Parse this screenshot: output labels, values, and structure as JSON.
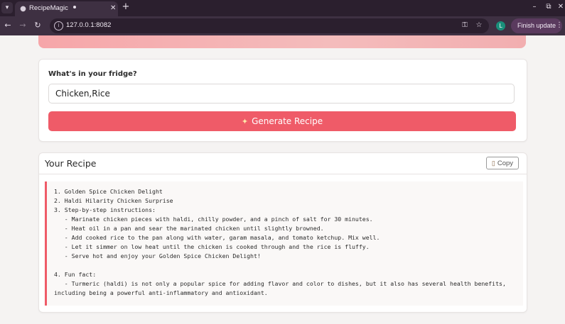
{
  "browser": {
    "tab_title": "RecipeMagic",
    "url": "127.0.0.1:8082",
    "profile_initial": "L",
    "finish_update_label": "Finish update"
  },
  "form": {
    "label": "What's in your fridge?",
    "ingredients_value": "Chicken,Rice",
    "generate_label": "Generate Recipe"
  },
  "recipe": {
    "heading": "Your Recipe",
    "copy_label": "Copy",
    "lines": [
      "1. Golden Spice Chicken Delight",
      "2. Haldi Hilarity Chicken Surprise",
      "3. Step-by-step instructions:",
      "   - Marinate chicken pieces with haldi, chilly powder, and a pinch of salt for 30 minutes.",
      "   - Heat oil in a pan and sear the marinated chicken until slightly browned.",
      "   - Add cooked rice to the pan along with water, garam masala, and tomato ketchup. Mix well.",
      "   - Let it simmer on low heat until the chicken is cooked through and the rice is fluffy.",
      "   - Serve hot and enjoy your Golden Spice Chicken Delight!",
      "",
      "4. Fun fact:",
      "   - Turmeric (haldi) is not only a popular spice for adding flavor and color to dishes, but it also has several health benefits, including being a powerful anti-inflammatory and antioxidant."
    ]
  },
  "icons": {
    "tab_list": "chevron-down-icon",
    "favicon": "globe-icon",
    "new_tab": "plus-icon",
    "back": "arrow-left-icon",
    "forward": "arrow-right-icon",
    "reload": "reload-icon",
    "site_info": "info-icon",
    "password": "key-icon",
    "bookmark": "star-icon",
    "generate": "magic-wand-icon",
    "copy": "clipboard-icon"
  },
  "colors": {
    "accent": "#ef5b68",
    "banner": "#f4bcbc",
    "page_bg": "#f5f3f2",
    "chrome_bg": "#2b1f2e"
  }
}
